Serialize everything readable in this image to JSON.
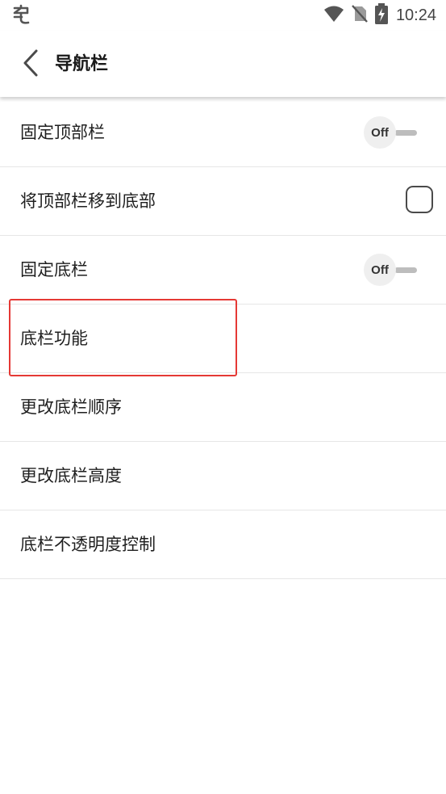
{
  "status_bar": {
    "time": "10:24",
    "icons": [
      "app-notification-icon",
      "wifi-icon",
      "no-sim-icon",
      "battery-charging-icon"
    ]
  },
  "header": {
    "title": "导航栏",
    "back_icon": "back-chevron-icon"
  },
  "settings": [
    {
      "label": "固定顶部栏",
      "control": "toggle",
      "state": "Off"
    },
    {
      "label": "将顶部栏移到底部",
      "control": "checkbox",
      "checked": false
    },
    {
      "label": "固定底栏",
      "control": "toggle",
      "state": "Off"
    },
    {
      "label": "底栏功能",
      "control": "none",
      "highlighted": true
    },
    {
      "label": "更改底栏顺序",
      "control": "none"
    },
    {
      "label": "更改底栏高度",
      "control": "none"
    },
    {
      "label": "底栏不透明度控制",
      "control": "none"
    }
  ],
  "colors": {
    "highlight": "#e53935",
    "divider": "#e6e6e6",
    "toggle_knob": "#efefef"
  }
}
